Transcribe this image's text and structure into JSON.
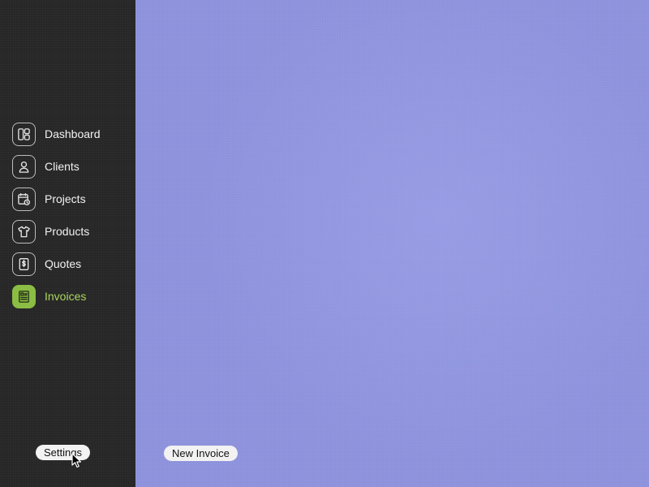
{
  "sidebar": {
    "items": [
      {
        "label": "Dashboard",
        "icon": "dashboard-icon",
        "active": false
      },
      {
        "label": "Clients",
        "icon": "person-icon",
        "active": false
      },
      {
        "label": "Projects",
        "icon": "calendar-clock-icon",
        "active": false
      },
      {
        "label": "Products",
        "icon": "tshirt-icon",
        "active": false
      },
      {
        "label": "Quotes",
        "icon": "dollar-document-icon",
        "active": false
      },
      {
        "label": "Invoices",
        "icon": "receipt-icon",
        "active": true
      }
    ],
    "settings_label": "Settings"
  },
  "main": {
    "new_invoice_label": "New Invoice"
  },
  "colors": {
    "sidebar_bg": "#262626",
    "main_bg": "#8c91db",
    "accent": "#8bbd45",
    "accent_text": "#a9d65c"
  }
}
